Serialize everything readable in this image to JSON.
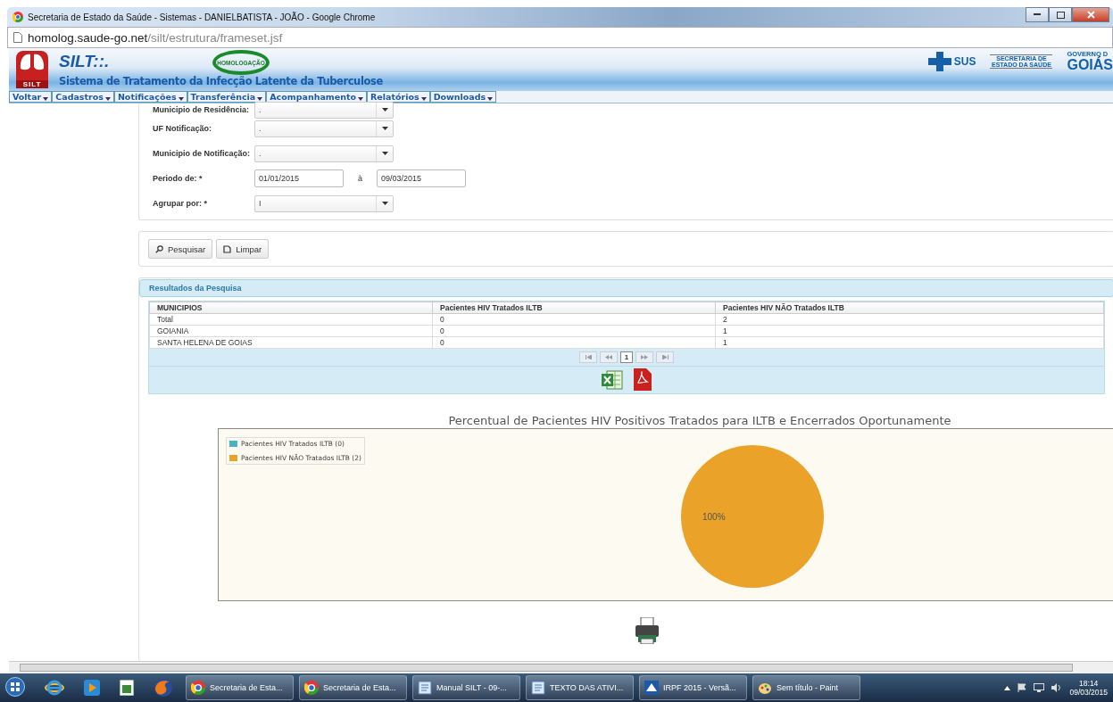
{
  "window": {
    "title": "Secretaria de Estado da Saúde - Sistemas - DANIELBATISTA - JOÃO - Google Chrome"
  },
  "address_bar": {
    "host": "homolog.saude-go.net",
    "path": "/silt/estrutura/frameset.jsf"
  },
  "header": {
    "logo_label": "SILT",
    "app_name": "SILT::.",
    "subtitle": "Sistema de Tratamento da Infecção Latente da Tuberculose",
    "stamp": "HOMOLOGAÇÃO",
    "sus": "SUS",
    "secretaria": "SECRETARIA DE ESTADO DA SAÚDE",
    "governo": "GOVERNO D",
    "goias": "GOIÁS"
  },
  "menu": [
    "Voltar",
    "Cadastros",
    "Notificações",
    "Transferência",
    "Acompanhamento",
    "Relatórios",
    "Downloads"
  ],
  "filters": [
    {
      "kind": "select",
      "label": "Municipio de Residência:",
      "value": "."
    },
    {
      "kind": "select",
      "label": "UF Notificação:",
      "value": "."
    },
    {
      "kind": "select",
      "label": "Municipio de Notificação:",
      "value": "."
    },
    {
      "kind": "range",
      "label": "Periodo de: *",
      "value": "01/01/2015",
      "separator": "à",
      "value_to": "09/03/2015"
    },
    {
      "kind": "select",
      "label": "Agrupar por: *",
      "value": "I"
    }
  ],
  "buttons": [
    {
      "kind": "search",
      "label": "Pesquisar"
    },
    {
      "kind": "clear",
      "label": "Limpar"
    }
  ],
  "results": {
    "title": "Resultados da Pesquisa",
    "columns": [
      "MUNICIPIOS",
      "Pacientes HIV Tratados ILTB",
      "Pacientes HIV NÃO Tratados ILTB"
    ],
    "rows": [
      [
        "Total",
        "0",
        "2"
      ],
      [
        "GOIANIA",
        "0",
        "1"
      ],
      [
        "SANTA HELENA DE GOIAS",
        "0",
        "1"
      ]
    ],
    "pages": [
      {
        "label": "1",
        "selected": true
      }
    ]
  },
  "chart": {
    "title": "Percentual de Pacientes HIV Positivos Tratados para ILTB e Encerrados Oportunamente",
    "slices": [
      {
        "color": "#4bb2c5"
      },
      {
        "color": "#eaa228"
      }
    ],
    "slice_label": "100%",
    "chart_data": {
      "type": "pie",
      "categories": [
        "Pacientes HIV Tratados ILTB (0)",
        "Pacientes HIV NÃO Tratados ILTB (2)"
      ],
      "values": [
        0,
        2
      ]
    }
  },
  "taskbar": {
    "tasks": [
      {
        "kind": "chrome",
        "label": "Secretaria de Esta..."
      },
      {
        "kind": "chrome",
        "label": "Secretaria de Esta..."
      },
      {
        "kind": "doc",
        "label": "Manual SILT - 09-..."
      },
      {
        "kind": "doc",
        "label": "TEXTO DAS ATIVI..."
      },
      {
        "kind": "app",
        "label": "IRPF 2015 - Versã..."
      },
      {
        "kind": "paint",
        "label": "Sem título - Paint"
      }
    ],
    "time": "18:14",
    "date": "09/03/2015"
  }
}
